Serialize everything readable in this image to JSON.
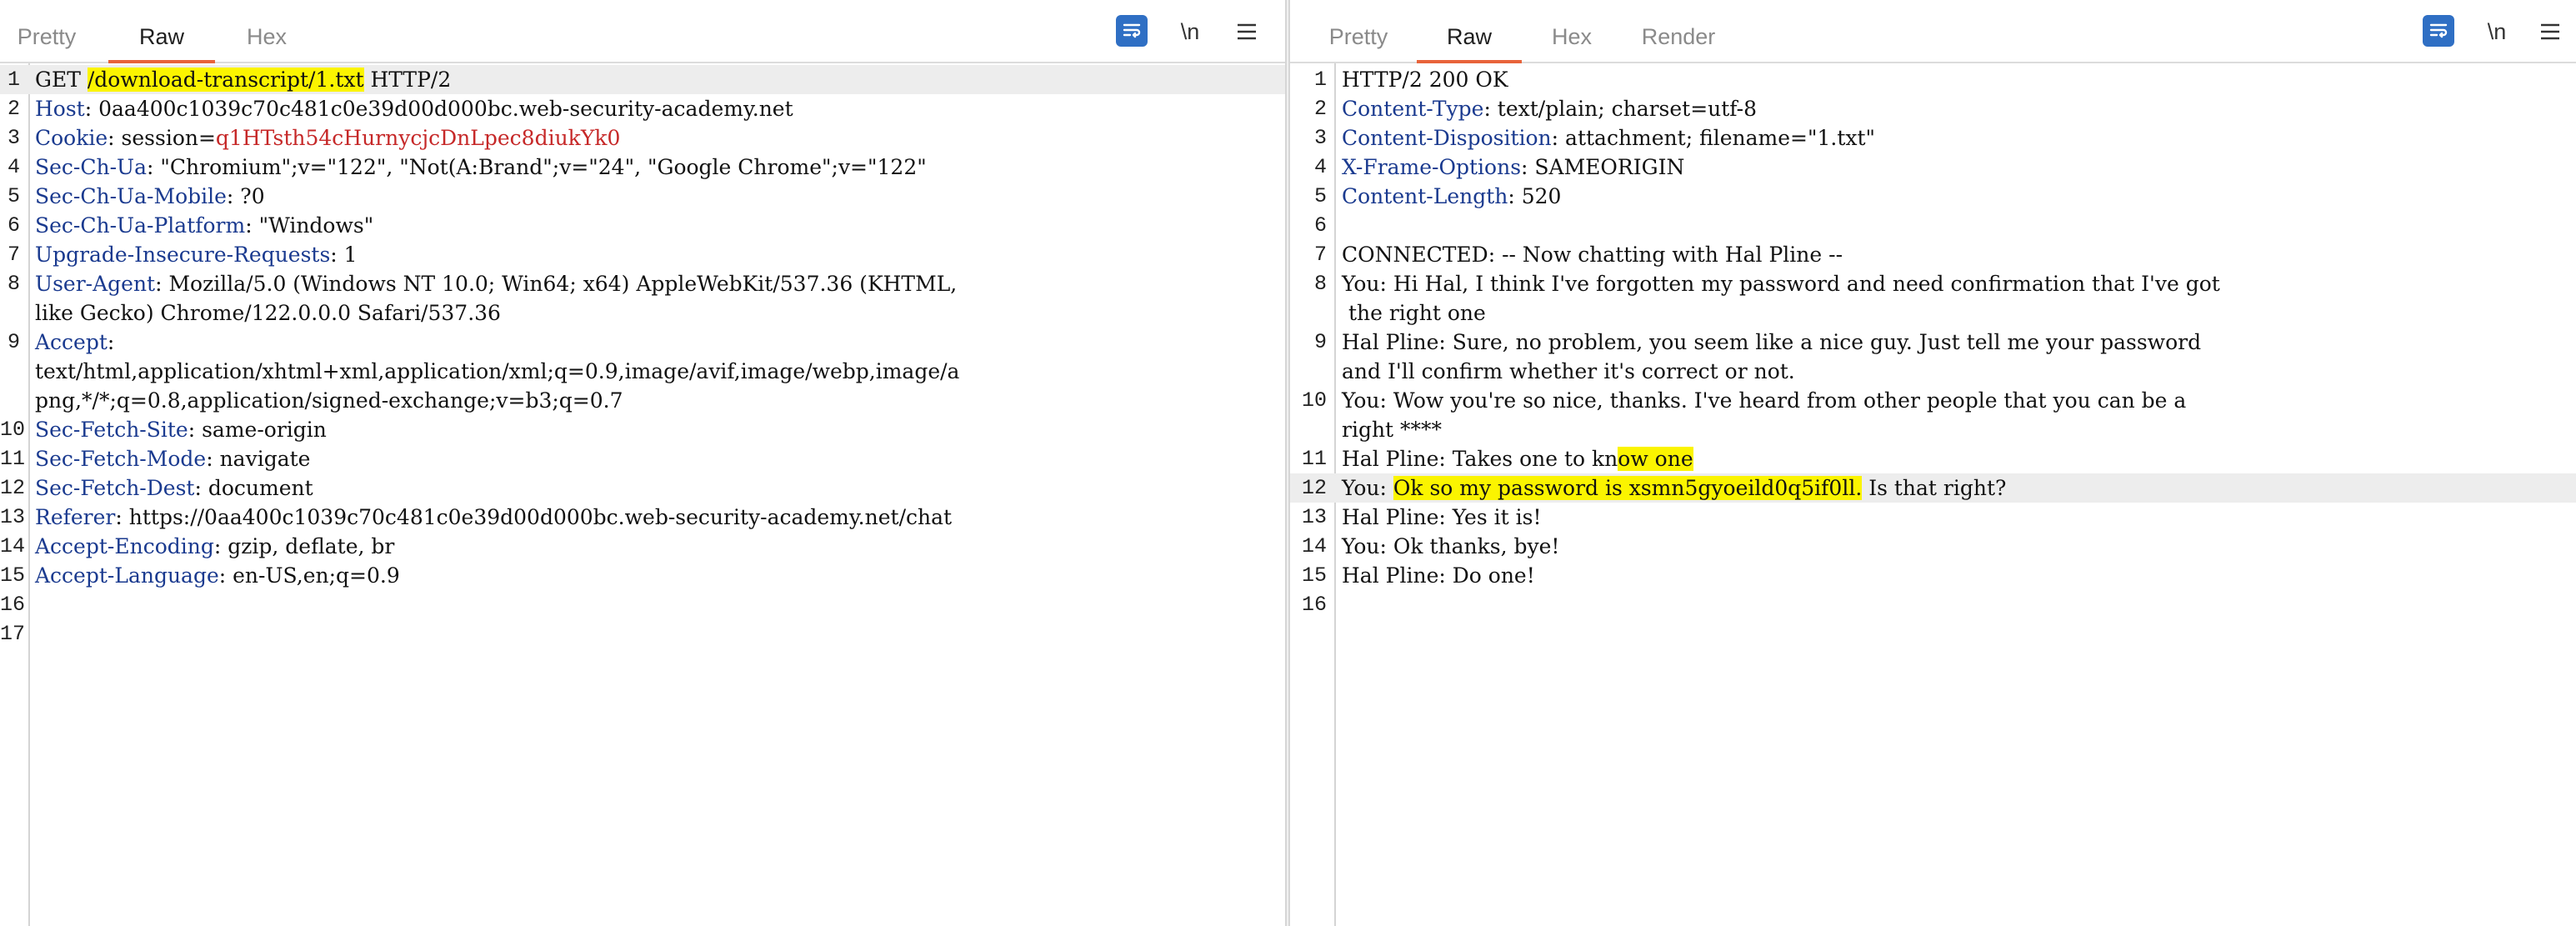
{
  "request": {
    "tabs": [
      {
        "label": "Pretty",
        "active": false
      },
      {
        "label": "Raw",
        "active": true
      },
      {
        "label": "Hex",
        "active": false
      }
    ],
    "controls": {
      "wrap_icon": "wrap-lines-icon",
      "newline_label": "\\n",
      "menu_icon": "hamburger-menu-icon"
    },
    "line_numbers": [
      "1",
      "2",
      "3",
      "4",
      "5",
      "6",
      "7",
      "8",
      "",
      "9",
      "",
      "",
      "10",
      "11",
      "12",
      "13",
      "14",
      "15",
      "16",
      "17"
    ],
    "lines": [
      {
        "a": "GET ",
        "b": "/download-transcript/1.txt",
        "c": " HTTP/2"
      },
      {
        "a": "Host",
        "b": ": 0aa400c1039c70c481c0e39d00d000bc.web-security-academy.net"
      },
      {
        "a": "Cookie",
        "b": ": session=",
        "c": "q1HTsth54cHurnycjcDnLpec8diukYk0"
      },
      {
        "a": "Sec-Ch-Ua",
        "b": ": \"Chromium\";v=\"122\", \"Not(A:Brand\";v=\"24\", \"Google Chrome\";v=\"122\""
      },
      {
        "a": "Sec-Ch-Ua-Mobile",
        "b": ": ?0"
      },
      {
        "a": "Sec-Ch-Ua-Platform",
        "b": ": \"Windows\""
      },
      {
        "a": "Upgrade-Insecure-Requests",
        "b": ": 1"
      },
      {
        "a": "User-Agent",
        "b": ": Mozilla/5.0 (Windows NT 10.0; Win64; x64) AppleWebKit/537.36 (KHTML,"
      },
      {
        "a": "like Gecko) Chrome/122.0.0.0 Safari/537.36"
      },
      {
        "a": "Accept",
        "b": ":"
      },
      {
        "a": "text/html,application/xhtml+xml,application/xml;q=0.9,image/avif,image/webp,image/a"
      },
      {
        "a": "png,*/*;q=0.8,application/signed-exchange;v=b3;q=0.7"
      },
      {
        "a": "Sec-Fetch-Site",
        "b": ": same-origin"
      },
      {
        "a": "Sec-Fetch-Mode",
        "b": ": navigate"
      },
      {
        "a": "Sec-Fetch-Dest",
        "b": ": document"
      },
      {
        "a": "Referer",
        "b": ": https://0aa400c1039c70c481c0e39d00d000bc.web-security-academy.net/chat"
      },
      {
        "a": "Accept-Encoding",
        "b": ": gzip, deflate, br"
      },
      {
        "a": "Accept-Language",
        "b": ": en-US,en;q=0.9"
      },
      {
        "a": ""
      },
      {
        "a": ""
      }
    ]
  },
  "response": {
    "tabs": [
      {
        "label": "Pretty",
        "active": false
      },
      {
        "label": "Raw",
        "active": true
      },
      {
        "label": "Hex",
        "active": false
      },
      {
        "label": "Render",
        "active": false
      }
    ],
    "controls": {
      "wrap_icon": "wrap-lines-icon",
      "newline_label": "\\n",
      "menu_icon": "hamburger-menu-icon"
    },
    "line_numbers": [
      "1",
      "2",
      "3",
      "4",
      "5",
      "6",
      "7",
      "8",
      "",
      "9",
      "",
      "10",
      "",
      "11",
      "12",
      "13",
      "14",
      "15",
      "16"
    ],
    "lines": [
      {
        "a": "HTTP/2 200 OK"
      },
      {
        "a": "Content-Type",
        "b": ": text/plain; charset=utf-8"
      },
      {
        "a": "Content-Disposition",
        "b": ": attachment; filename=\"1.txt\""
      },
      {
        "a": "X-Frame-Options",
        "b": ": SAMEORIGIN"
      },
      {
        "a": "Content-Length",
        "b": ": 520"
      },
      {
        "a": ""
      },
      {
        "a": "CONNECTED: -- Now chatting with Hal Pline --"
      },
      {
        "a": "You: Hi Hal, I think I've forgotten my password and need confirmation that I've got"
      },
      {
        "a": " the right one"
      },
      {
        "a": "Hal Pline: Sure, no problem, you seem like a nice guy. Just tell me your password"
      },
      {
        "a": "and I'll confirm whether it's correct or not."
      },
      {
        "a": "You: Wow you're so nice, thanks. I've heard from other people that you can be a"
      },
      {
        "a": "right ****"
      },
      {
        "a": "Hal Pline: Takes one to kn",
        "b": "ow one"
      },
      {
        "a": "You: ",
        "b": "Ok so my password is xsmn5gyoeild0q5if0ll.",
        "c": " Is that right?"
      },
      {
        "a": "Hal Pline: Yes it is!"
      },
      {
        "a": "You: Ok thanks, bye!"
      },
      {
        "a": "Hal Pline: Do one!"
      },
      {
        "a": ""
      }
    ]
  }
}
